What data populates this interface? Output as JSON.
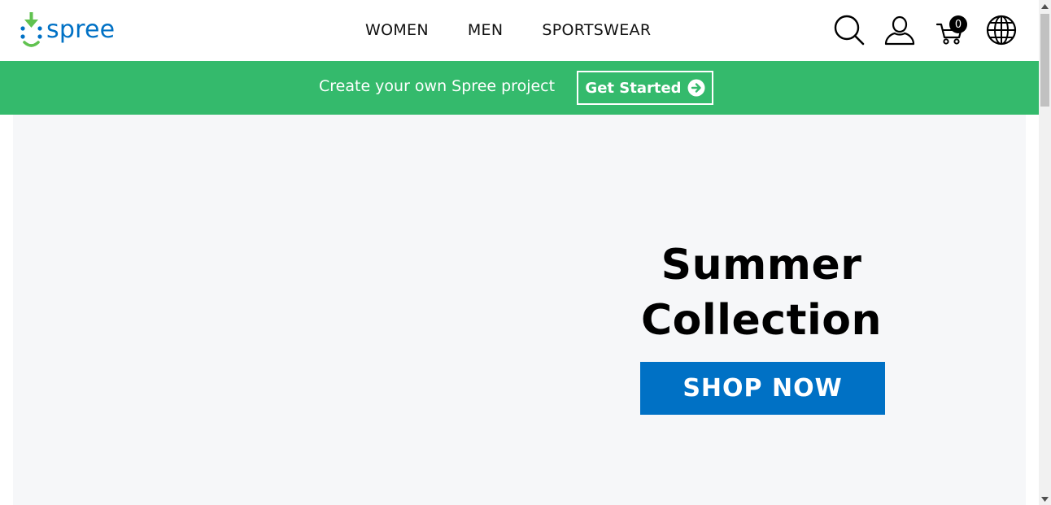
{
  "header": {
    "logo_text": "spree",
    "nav": [
      {
        "label": "WOMEN"
      },
      {
        "label": "MEN"
      },
      {
        "label": "SPORTSWEAR"
      }
    ],
    "icons": {
      "search": "search-icon",
      "account": "user-icon",
      "cart": "cart-icon",
      "globe": "globe-icon"
    },
    "cart_count": "0"
  },
  "promo": {
    "text": "Create your own Spree project",
    "button_label": "Get Started",
    "background": "#34ba6c"
  },
  "hero": {
    "title_line1": "Summer",
    "title_line2": "Collection",
    "button_label": "SHOP NOW",
    "button_color": "#0071c5",
    "background": "#f6f7f9"
  }
}
